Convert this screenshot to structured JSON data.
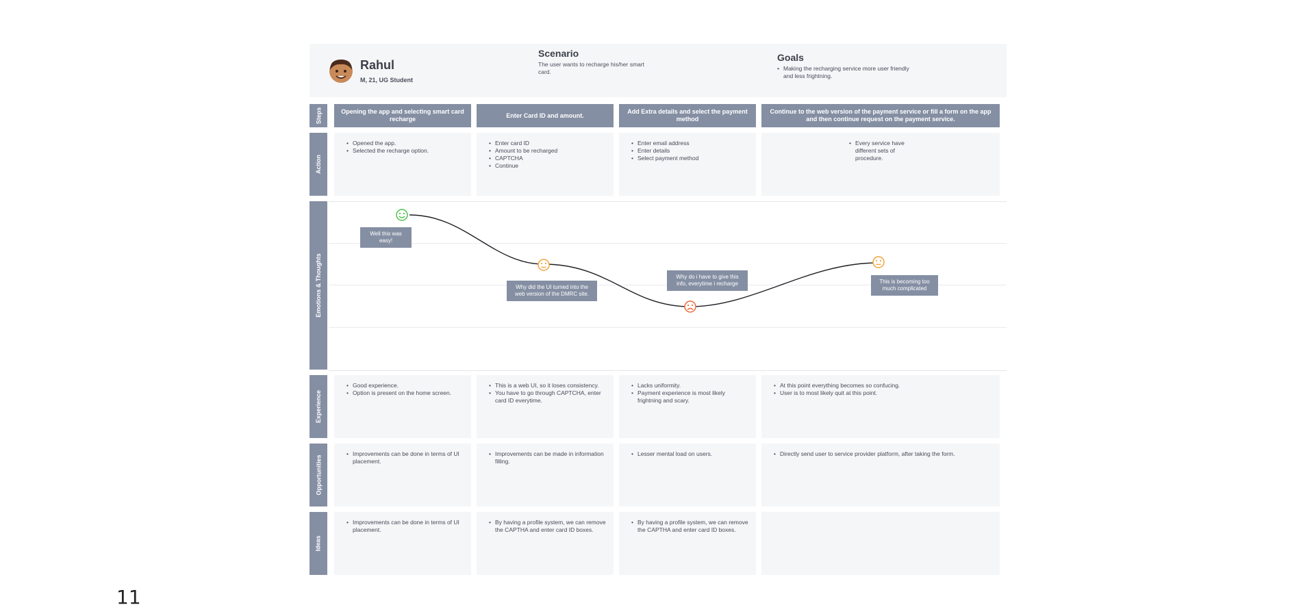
{
  "persona": {
    "name": "Rahul",
    "details": "M, 21, UG Student"
  },
  "scenario": {
    "title": "Scenario",
    "text": "The user wants to recharge his/her smart card."
  },
  "goals": {
    "title": "Goals",
    "items": [
      "Making the recharging service more user friendly and less frightning."
    ]
  },
  "row_labels": {
    "steps": "Steps",
    "action": "Action",
    "emotions": "Emotions & Thoughts",
    "experience": "Experience",
    "opportunities": "Opportunities",
    "ideas": "Ideas"
  },
  "steps": [
    "Opening the app and selecting smart card recharge",
    "Enter Card ID and amount.",
    "Add Extra details and select the payment method",
    "Continue to the web version of the payment service or fill a form on the app and then continue request on the payment service."
  ],
  "actions": [
    [
      "Opened the app.",
      "Selected the recharge option."
    ],
    [
      "Enter card ID",
      "Amount to be recharged",
      "CAPTCHA",
      "Continue"
    ],
    [
      "Enter email address",
      "Enter details",
      "Select payment method"
    ],
    [
      "Every service have different sets of procedure."
    ]
  ],
  "emotions": [
    {
      "mood": "happy",
      "thought": "Well this was easy!",
      "icon": "happy-face-icon",
      "color": "#4cc24a"
    },
    {
      "mood": "neutral",
      "thought": "Why did the UI turned into the web version of the DMRC site.",
      "icon": "neutral-face-icon",
      "color": "#f3a43a"
    },
    {
      "mood": "sad",
      "thought": "Why do i have to give this info, everytime i recharge",
      "icon": "sad-face-icon",
      "color": "#ee6a3a"
    },
    {
      "mood": "neutral",
      "thought": "This is becoming too much complicated",
      "icon": "neutral-face-icon",
      "color": "#f3a43a"
    }
  ],
  "experience": [
    [
      "Good experience.",
      "Option is present on the home screen."
    ],
    [
      "This is a web UI, so it loses consistency.",
      "You have to go through CAPTCHA, enter card ID everytime."
    ],
    [
      "Lacks uniformity.",
      "Payment experience is most likely frightning and scary."
    ],
    [
      "At this point everything becomes so confucing.",
      "User is to most likely quit at this point."
    ]
  ],
  "opportunities": [
    [
      "Improvements can be done in terms of UI placement."
    ],
    [
      "Improvements can be made in information filling."
    ],
    [
      "Lesser mental load on users."
    ],
    [
      "Directly send user to service provider platform, after taking the form."
    ]
  ],
  "ideas": [
    [
      "Improvements can be done in terms of UI placement."
    ],
    [
      "By having a profile system, we can remove the CAPTHA and enter card ID boxes."
    ],
    [
      "By having a profile system, we can remove the CAPTHA and enter card ID boxes."
    ],
    []
  ],
  "page_number": "11",
  "colors": {
    "accent": "#858fa3",
    "cell_bg": "#f5f6f8",
    "happy": "#4cc24a",
    "neutral": "#f3a43a",
    "sad": "#ee6a3a"
  }
}
